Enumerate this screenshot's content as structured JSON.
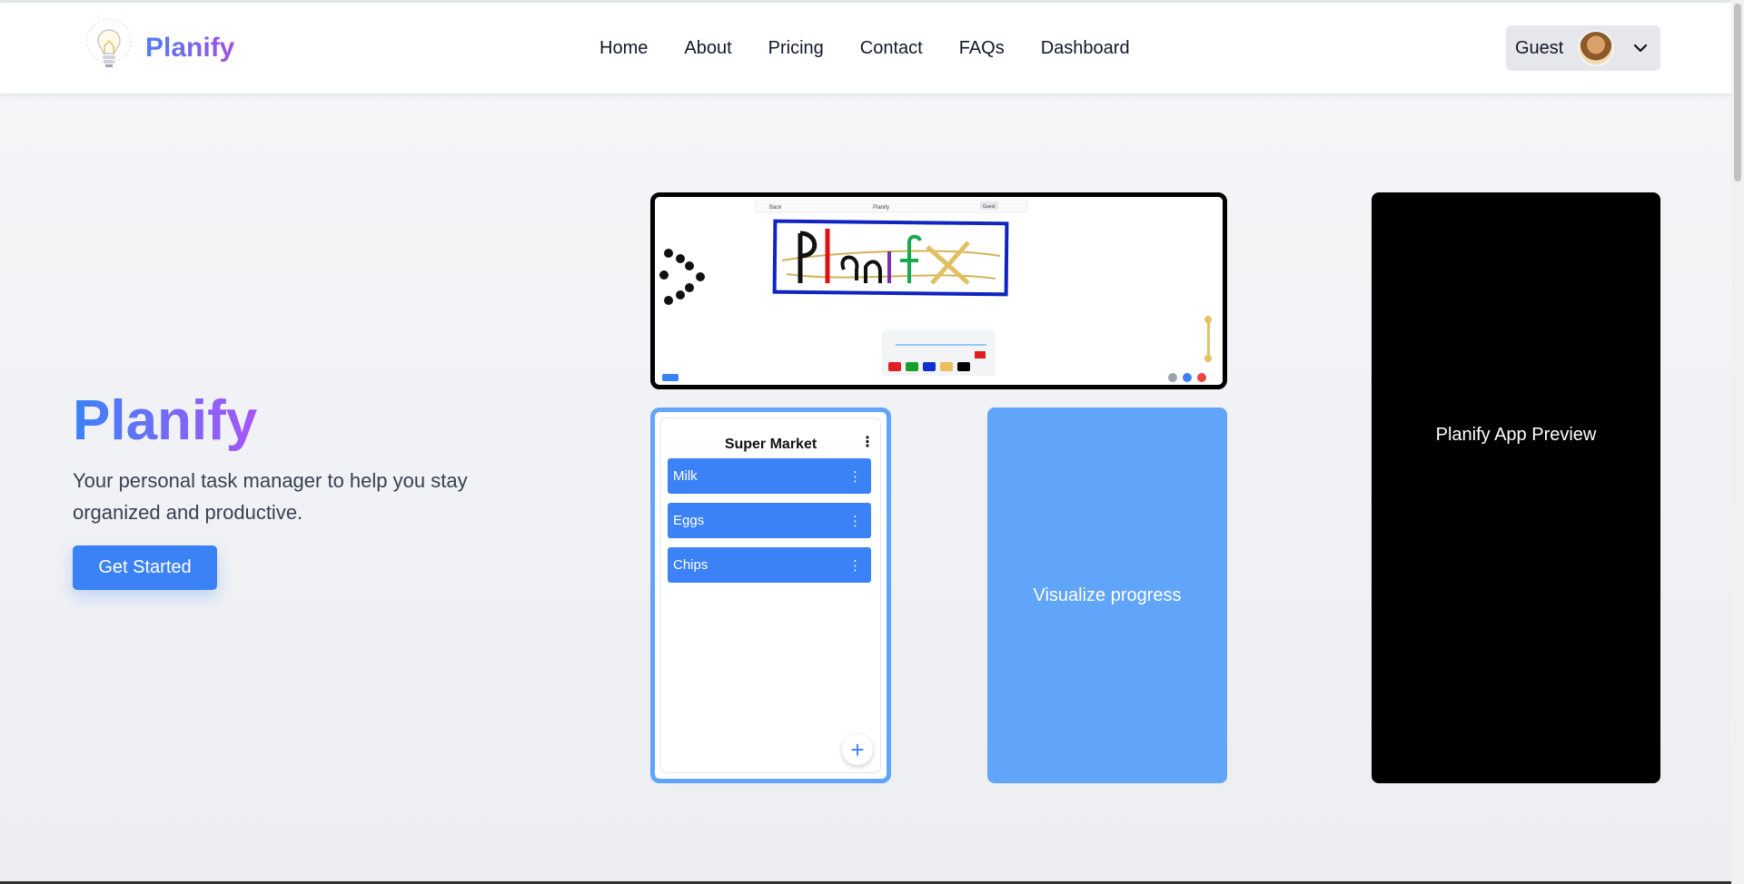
{
  "navbar": {
    "brand_name": "Planify",
    "links": [
      "Home",
      "About",
      "Pricing",
      "Contact",
      "FAQs",
      "Dashboard"
    ],
    "user": {
      "name": "Guest"
    }
  },
  "hero": {
    "title": "Planify",
    "subtitle": "Your personal task manager to help you stay organized and productive.",
    "cta_label": "Get Started"
  },
  "screenshot_preview": {
    "back_label": "Back",
    "title": "Planify",
    "user_label": "Guest",
    "drawn_word": "Planify",
    "palette": [
      "#e02020",
      "#1a9e2a",
      "#1030d0",
      "#e8c060",
      "#000000"
    ]
  },
  "list_card": {
    "title": "Super Market",
    "items": [
      "Milk",
      "Eggs",
      "Chips"
    ],
    "add_label": "+"
  },
  "progress_card": {
    "label": "Visualize progress"
  },
  "preview_card": {
    "label": "Planify App Preview"
  },
  "colors": {
    "accent": "#3b82f6",
    "card_blue": "#60a5fa",
    "brand_gradient_start": "#4f7ff0",
    "brand_gradient_end": "#a050e0"
  }
}
